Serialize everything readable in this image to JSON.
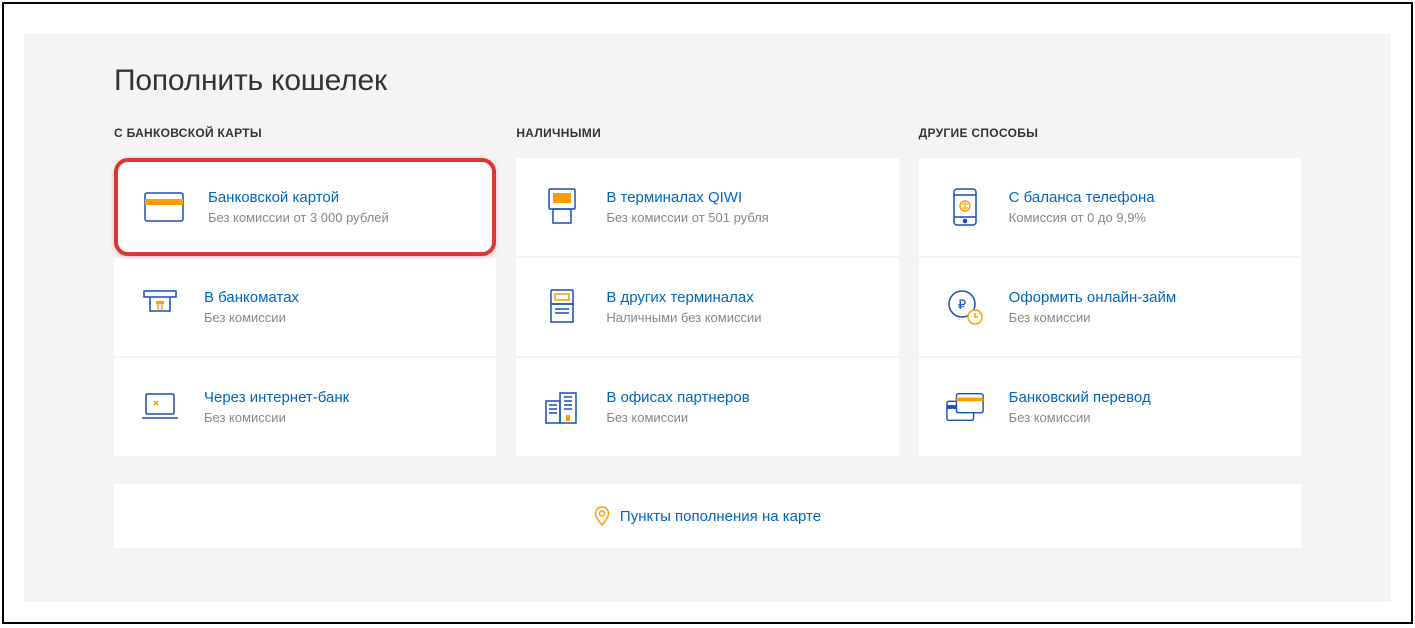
{
  "page": {
    "title": "Пополнить кошелек"
  },
  "columns": [
    {
      "header": "С БАНКОВСКОЙ КАРТЫ",
      "items": [
        {
          "title": "Банковской картой",
          "sub": "Без комиссии от 3 000 рублей"
        },
        {
          "title": "В банкоматах",
          "sub": "Без комиссии"
        },
        {
          "title": "Через интернет-банк",
          "sub": "Без комиссии"
        }
      ]
    },
    {
      "header": "НАЛИЧНЫМИ",
      "items": [
        {
          "title": "В терминалах QIWI",
          "sub": "Без комиссии от 501 рубля"
        },
        {
          "title": "В других терминалах",
          "sub": "Наличными без комиссии"
        },
        {
          "title": "В офисах партнеров",
          "sub": "Без комиссии"
        }
      ]
    },
    {
      "header": "ДРУГИЕ СПОСОБЫ",
      "items": [
        {
          "title": "С баланса телефона",
          "sub": "Комиссия от 0 до 9,9%"
        },
        {
          "title": "Оформить онлайн-займ",
          "sub": "Без комиссии"
        },
        {
          "title": "Банковский перевод",
          "sub": "Без комиссии"
        }
      ]
    }
  ],
  "map_link": "Пункты пополнения на карте"
}
